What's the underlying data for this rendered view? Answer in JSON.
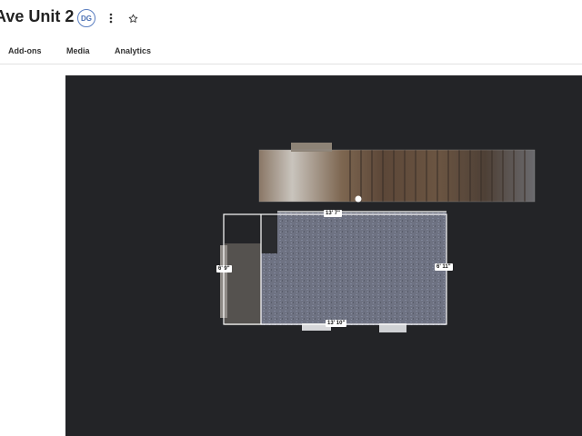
{
  "header": {
    "title": "Ave Unit 2",
    "avatar_initials": "DG"
  },
  "tabs": [
    {
      "label": "Add-ons"
    },
    {
      "label": "Media"
    },
    {
      "label": "Analytics"
    }
  ],
  "viewer": {
    "background_color": "#232427",
    "measurements": {
      "top": "13' 7\"",
      "left": "6' 9\"",
      "right": "6' 11\"",
      "bottom": "13' 10\""
    }
  }
}
